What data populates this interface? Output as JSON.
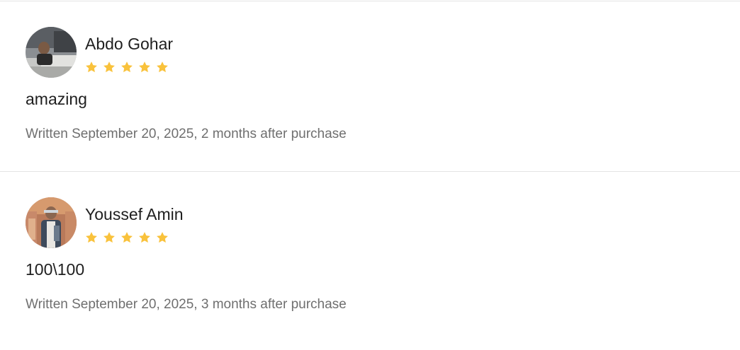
{
  "reviews": [
    {
      "reviewer": "Abdo Gohar",
      "rating": 5,
      "text": "amazing",
      "meta": "Written September 20, 2025, 2 months after purchase"
    },
    {
      "reviewer": "Youssef Amin",
      "rating": 5,
      "text": "100\\100",
      "meta": "Written September 20, 2025, 3 months after purchase"
    }
  ],
  "colors": {
    "star": "#F9C23C",
    "divider": "#E4E4E4",
    "meta_text": "#6F6F6F"
  },
  "icons": {
    "rating": "star-icon"
  }
}
